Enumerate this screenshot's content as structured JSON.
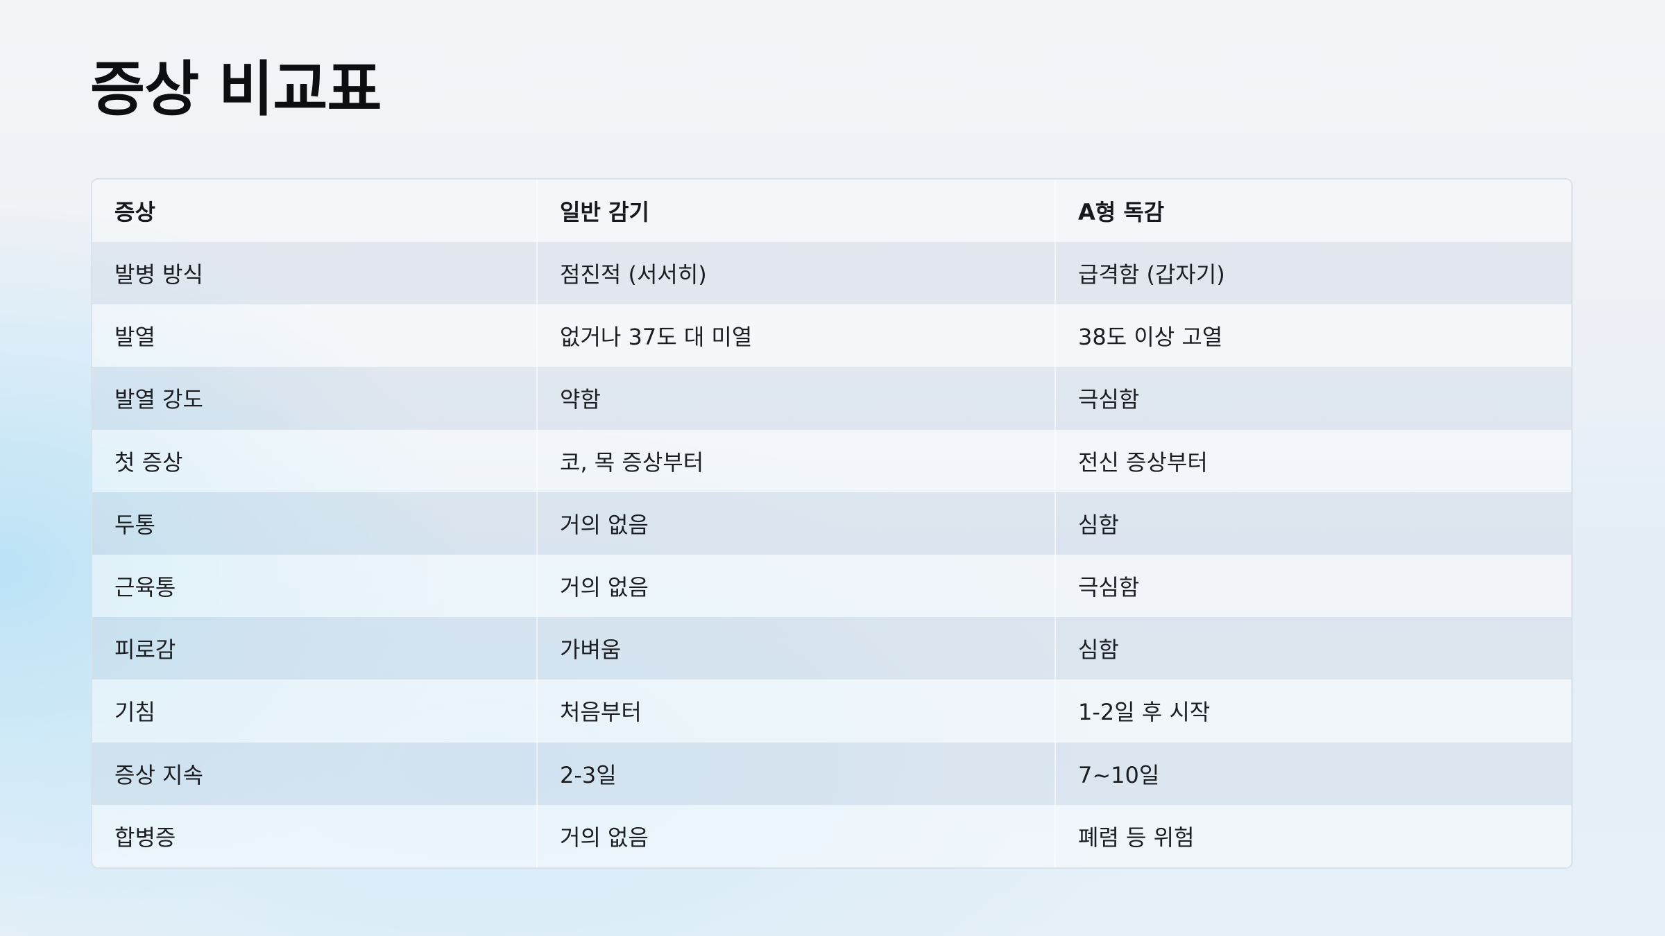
{
  "title": "증상 비교표",
  "table": {
    "headers": [
      "증상",
      "일반 감기",
      "A형 독감"
    ],
    "rows": [
      [
        "발병 방식",
        "점진적 (서서히)",
        "급격함 (갑자기)"
      ],
      [
        "발열",
        "없거나 37도 대 미열",
        "38도 이상 고열"
      ],
      [
        "발열 강도",
        "약함",
        "극심함"
      ],
      [
        "첫 증상",
        "코, 목 증상부터",
        "전신 증상부터"
      ],
      [
        "두통",
        "거의 없음",
        "심함"
      ],
      [
        "근육통",
        "거의 없음",
        "극심함"
      ],
      [
        "피로감",
        "가벼움",
        "심함"
      ],
      [
        "기침",
        "처음부터",
        "1-2일 후 시작"
      ],
      [
        "증상 지속",
        "2-3일",
        "7~10일"
      ],
      [
        "합병증",
        "거의 없음",
        "폐렴 등 위험"
      ]
    ]
  }
}
